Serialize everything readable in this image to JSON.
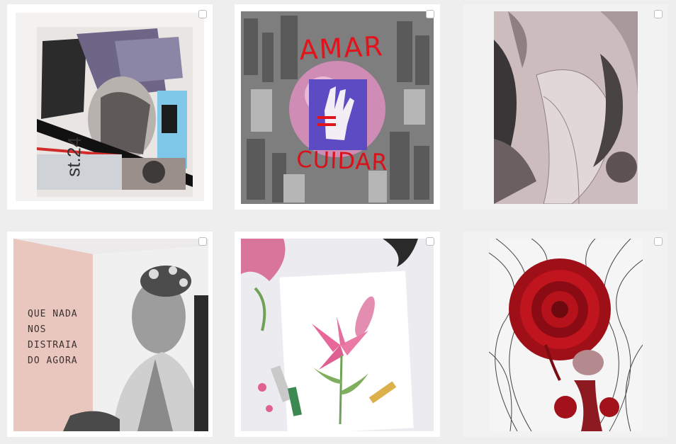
{
  "gallery": {
    "posts": [
      {
        "label": "Collage artwork post"
      },
      {
        "label": "AMAR = CUIDAR post",
        "text_top": "AMAR",
        "text_bottom": "CUIDAR"
      },
      {
        "label": "Botanical illustration post"
      },
      {
        "label": "Mural post",
        "wall_lines": [
          "QUE NADA",
          "NOS DISTRAIA",
          "DO AGORA"
        ]
      },
      {
        "label": "Lily watercolor post"
      },
      {
        "label": "Red rose ink drawing post"
      }
    ]
  },
  "colors": {
    "background": "#eeeeee",
    "accent_red": "#e1141c",
    "checkbox_border": "#bdbdbd"
  }
}
